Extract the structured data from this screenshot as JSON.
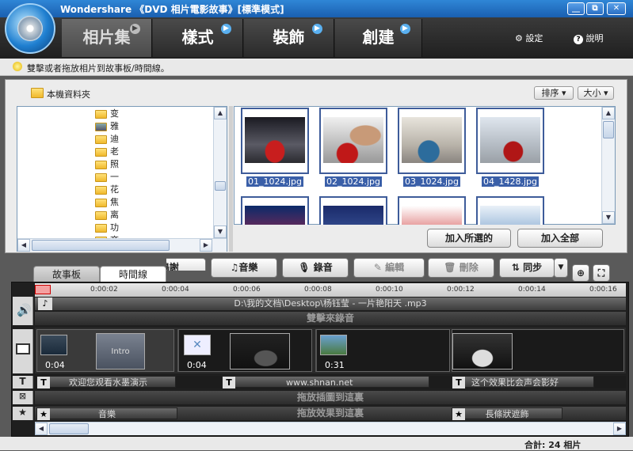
{
  "window": {
    "title": "Wondershare 《DVD 相片電影故事》[標準模式]",
    "minimize_label": "__",
    "restore_label": "⧉",
    "close_label": "✕"
  },
  "nav": {
    "tabs": [
      {
        "label": "相片集",
        "icon": "arrow-right-icon"
      },
      {
        "label": "樣式",
        "icon": "arrow-right-icon"
      },
      {
        "label": "裝飾",
        "icon": "arrow-right-icon"
      },
      {
        "label": "創建",
        "icon": "arrow-right-icon"
      }
    ],
    "settings_label": "設定",
    "help_label": "說明"
  },
  "hint": {
    "text": "雙擊或者拖放相片到故事板/時間線。"
  },
  "library": {
    "folder_title": "本機資料夾",
    "sort_label": "排序",
    "size_label": "大小",
    "tree_items": [
      "变",
      "雅",
      "迪",
      "老",
      "照",
      "一",
      "花",
      "焦",
      "离",
      "功",
      "商"
    ],
    "photos": [
      {
        "name": "01_1024.jpg"
      },
      {
        "name": "02_1024.jpg"
      },
      {
        "name": "03_1024.jpg"
      },
      {
        "name": "04_1428.jpg"
      }
    ],
    "add_selected_label": "加入所選的",
    "add_all_label": "加入全部"
  },
  "toolbar": {
    "voice_label": "鳴謝",
    "music_label": "音樂",
    "record_label": "錄音",
    "edit_label": "編輯",
    "delete_label": "刪除",
    "sync_label": "同步"
  },
  "view_tabs": {
    "storyboard_label": "故事板",
    "timeline_label": "時間線"
  },
  "timeline": {
    "ticks": [
      "0:00:02",
      "0:00:04",
      "0:00:06",
      "0:00:08",
      "0:00:10",
      "0:00:12",
      "0:00:14",
      "0:00:16"
    ],
    "audio_file": "D:\\我的文档\\Desktop\\杨钰莹 - 一片艳阳天 .mp3",
    "record_zone": "雙擊來錄音",
    "clip_durations": [
      "0:04",
      "0:04",
      "0:31"
    ],
    "intro_label": "Intro",
    "text_clips": [
      "欢迎您观看水墨演示",
      "www.shnan.net",
      "这个效果比会声会影好"
    ],
    "insert_zone": "拖放插圖到這裏",
    "effect_zone": "拖放效果到這裏",
    "effect_clips": [
      "音樂",
      "長條狀遮飾"
    ]
  },
  "status": {
    "total": "合計: 24 相片"
  }
}
